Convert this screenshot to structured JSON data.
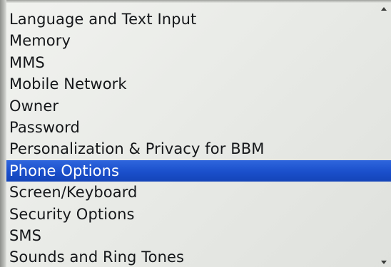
{
  "options_list": {
    "items": [
      {
        "label": "Language and Text Input",
        "selected": false
      },
      {
        "label": "Memory",
        "selected": false
      },
      {
        "label": "MMS",
        "selected": false
      },
      {
        "label": "Mobile Network",
        "selected": false
      },
      {
        "label": "Owner",
        "selected": false
      },
      {
        "label": "Password",
        "selected": false
      },
      {
        "label": "Personalization & Privacy for BBM",
        "selected": false
      },
      {
        "label": "Phone Options",
        "selected": true
      },
      {
        "label": "Screen/Keyboard",
        "selected": false
      },
      {
        "label": "Security Options",
        "selected": false
      },
      {
        "label": "SMS",
        "selected": false
      },
      {
        "label": "Sounds and Ring Tones",
        "selected": false
      }
    ]
  },
  "colors": {
    "selection": "#1a4fcb",
    "text": "#15171a",
    "background": "#eceeea"
  },
  "icons": {
    "scroll_up": "scroll-up-arrow-icon",
    "scroll_down": "scroll-down-arrow-icon"
  }
}
